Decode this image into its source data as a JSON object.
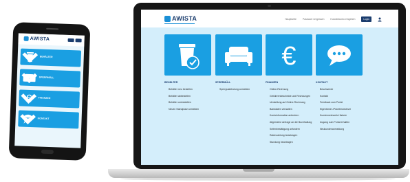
{
  "brand": {
    "logo_text": "AWISTA",
    "accent": "#1a9fe2",
    "navy": "#1b3d6e"
  },
  "nav": {
    "links": [
      "Hauptseite",
      "Passwort vergessen",
      "Kundenkonto eingeben"
    ],
    "login": "Login",
    "user_icon": "user-icon"
  },
  "categories": [
    {
      "title": "BEHÄLTER",
      "icon": "waste-bin-icon",
      "links": [
        "Behälter neu bestellen",
        "Behälter abbestellen",
        "Behälter umbestellen",
        "Neuen Standplatz anmelden"
      ]
    },
    {
      "title": "SPERRMÜLL",
      "icon": "sofa-icon",
      "links": [
        "Sperrgutabholung anmelden"
      ]
    },
    {
      "title": "FINANZEN",
      "icon": "euro-icon",
      "links": [
        "Online-Rechnung",
        "Gebührenbescheide und Rechnungen",
        "Umstellung auf Online-Rechnung",
        "Bankdaten verwalten",
        "Kontoinformation anfordern",
        "Allgemeine Anfrage an die Buchhaltung",
        "Seitenbestätigung anfordern",
        "Ratenzahlung beantragen",
        "Stundung beantragen"
      ]
    },
    {
      "title": "KONTAKT",
      "icon": "chat-bubble-icon",
      "links": [
        "Beschwerde",
        "Kontakt",
        "Feedback zum Portal",
        "Eigentümer-/Pächterwechsel",
        "Kundennetzwerk-Historie",
        "Zugang zum Portal erhalten",
        "Neukundenanmeldung"
      ]
    }
  ],
  "phone": {
    "logo_text": "AWISTA",
    "items": [
      {
        "label": "BEHÄLTER",
        "icon": "waste-bin-icon"
      },
      {
        "label": "SPERRMÜLL",
        "icon": "sofa-icon"
      },
      {
        "label": "FINANZEN",
        "icon": "euro-icon"
      },
      {
        "label": "KONTAKT",
        "icon": "chat-bubble-icon"
      }
    ]
  }
}
